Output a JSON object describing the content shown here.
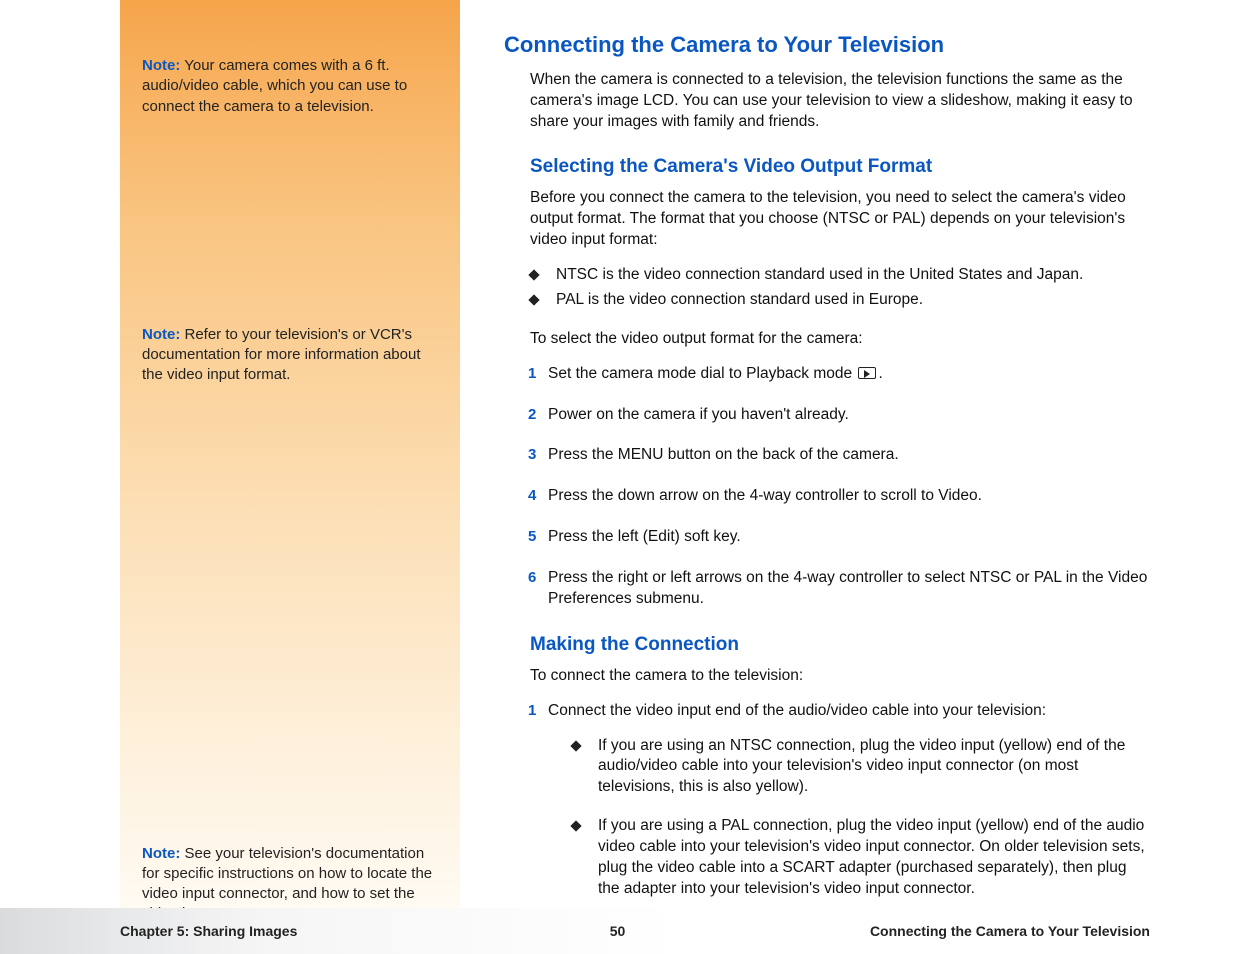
{
  "sidebar": {
    "note_label": "Note:",
    "notes": [
      "Your camera comes with a 6 ft. audio/video cable, which you can use to connect the camera to a television.",
      "Refer to your television's or VCR's documentation for more information about the video input format.",
      "See your television's documentation for specific instructions on how to locate the video input connector, and how to set the video input."
    ]
  },
  "main": {
    "h1": "Connecting the Camera to Your Television",
    "intro": "When the camera is connected to a television, the television functions the same as the camera's image LCD. You can use your television to view a slideshow, making it easy to share your images with family and friends.",
    "section1": {
      "heading": "Selecting the Camera's Video Output Format",
      "p1": "Before you connect the camera to the television, you need to select the camera's video output format. The format that you choose (NTSC or PAL) depends on your television's video input format:",
      "bullets": [
        "NTSC is the video connection standard used in the United States and Japan.",
        "PAL is the video connection standard used in Europe."
      ],
      "p2": "To select the video output format for the camera:",
      "steps": [
        "Set the camera mode dial to Playback mode",
        "Power on the camera if you haven't already.",
        "Press the MENU button on the back of the camera.",
        "Press the down arrow on the 4-way controller to scroll to Video.",
        "Press the left (Edit) soft key.",
        "Press the right or left arrows on the 4-way controller to select NTSC or PAL in the Video Preferences submenu."
      ],
      "step1_suffix": "."
    },
    "section2": {
      "heading": "Making the Connection",
      "p1": "To connect the camera to the television:",
      "step1": "Connect the video input end of the audio/video cable into your television:",
      "sub_bullets": [
        "If you are using an NTSC connection, plug the video input (yellow) end of the audio/video cable into your television's video input connector (on most televisions, this is also yellow).",
        "If you are using a PAL connection, plug the video input (yellow) end of the audio video cable into your television's video input connector. On older television sets, plug the video cable into a SCART adapter (purchased separately), then plug the adapter into your television's video input connector."
      ]
    }
  },
  "footer": {
    "left": "Chapter 5: Sharing Images",
    "center": "50",
    "right": "Connecting the Camera to Your Television"
  }
}
